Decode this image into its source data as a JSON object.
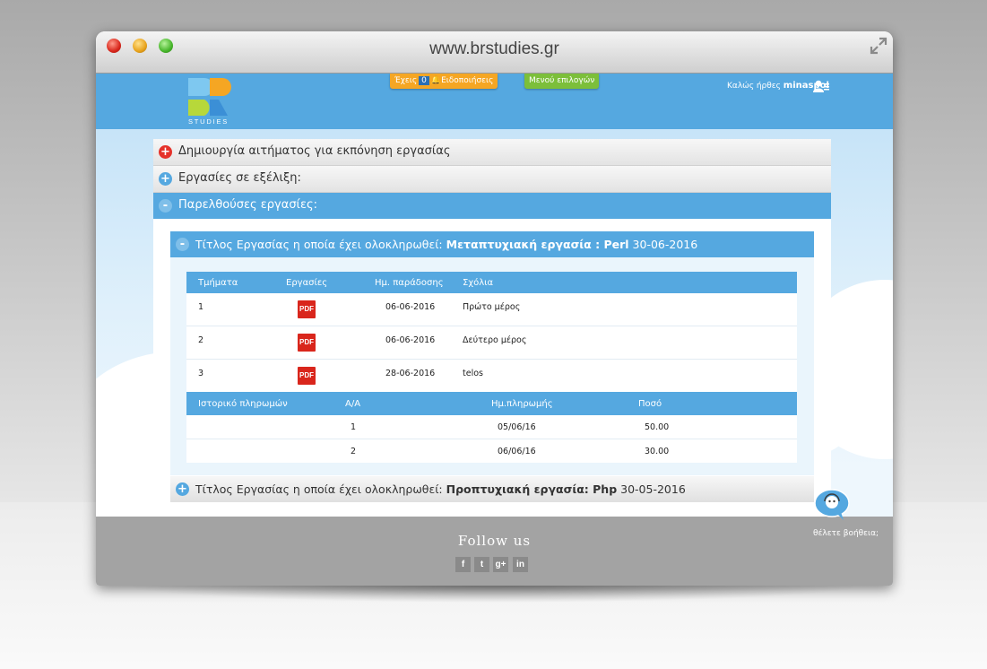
{
  "window": {
    "url": "www.brstudies.gr"
  },
  "header": {
    "logo_text": "STUDIES",
    "notif": {
      "prefix": "Έχεις",
      "count": "0",
      "label": "Ειδοποιήσεις"
    },
    "menu_label": "Μενού επιλογών",
    "welcome": "Καλώς ήρθες",
    "username": "minaspol"
  },
  "accordion": [
    {
      "label": "Δημιουργία αιτήματος για εκπόνηση εργασίας",
      "icon": "+"
    },
    {
      "label": "Εργασίες σε εξέλιξη:",
      "icon": "+"
    },
    {
      "label": "Παρελθούσες εργασίες:",
      "icon": "-"
    }
  ],
  "past_works": [
    {
      "prefix": "Τίτλος Εργασίας η οποία έχει ολοκληρωθεί:",
      "title": "Μεταπτυχιακή εργασία : Perl",
      "date": "30-06-2016",
      "icon": "-"
    },
    {
      "prefix": "Τίτλος Εργασίας η οποία έχει ολοκληρωθεί:",
      "title": "Προπτυχιακή εργασία: Php",
      "date": "30-05-2016",
      "icon": "+"
    }
  ],
  "parts_table": {
    "headers": [
      "Τμήματα",
      "Εργασίες",
      "Ημ. παράδοσης",
      "Σχόλια"
    ],
    "pdf_label": "PDF",
    "rows": [
      {
        "part": "1",
        "date": "06-06-2016",
        "comment": "Πρώτο μέρος"
      },
      {
        "part": "2",
        "date": "06-06-2016",
        "comment": "Δεύτερο μέρος"
      },
      {
        "part": "3",
        "date": "28-06-2016",
        "comment": "telos"
      }
    ]
  },
  "payments_table": {
    "headers": [
      "Ιστορικό πληρωμών",
      "Α/Α",
      "Ημ.πληρωμής",
      "Ποσό"
    ],
    "rows": [
      {
        "aa": "1",
        "date": "05/06/16",
        "amount": "50.00"
      },
      {
        "aa": "2",
        "date": "06/06/16",
        "amount": "30.00"
      }
    ]
  },
  "footer": {
    "follow": "Follow us",
    "social": [
      "f",
      "t",
      "g+",
      "in"
    ]
  },
  "help": {
    "label": "θέλετε βοήθεια;"
  },
  "colors": {
    "primary": "#55a8e0",
    "notif": "#f5a623",
    "menu": "#7cbf3a",
    "danger": "#d9261c"
  }
}
